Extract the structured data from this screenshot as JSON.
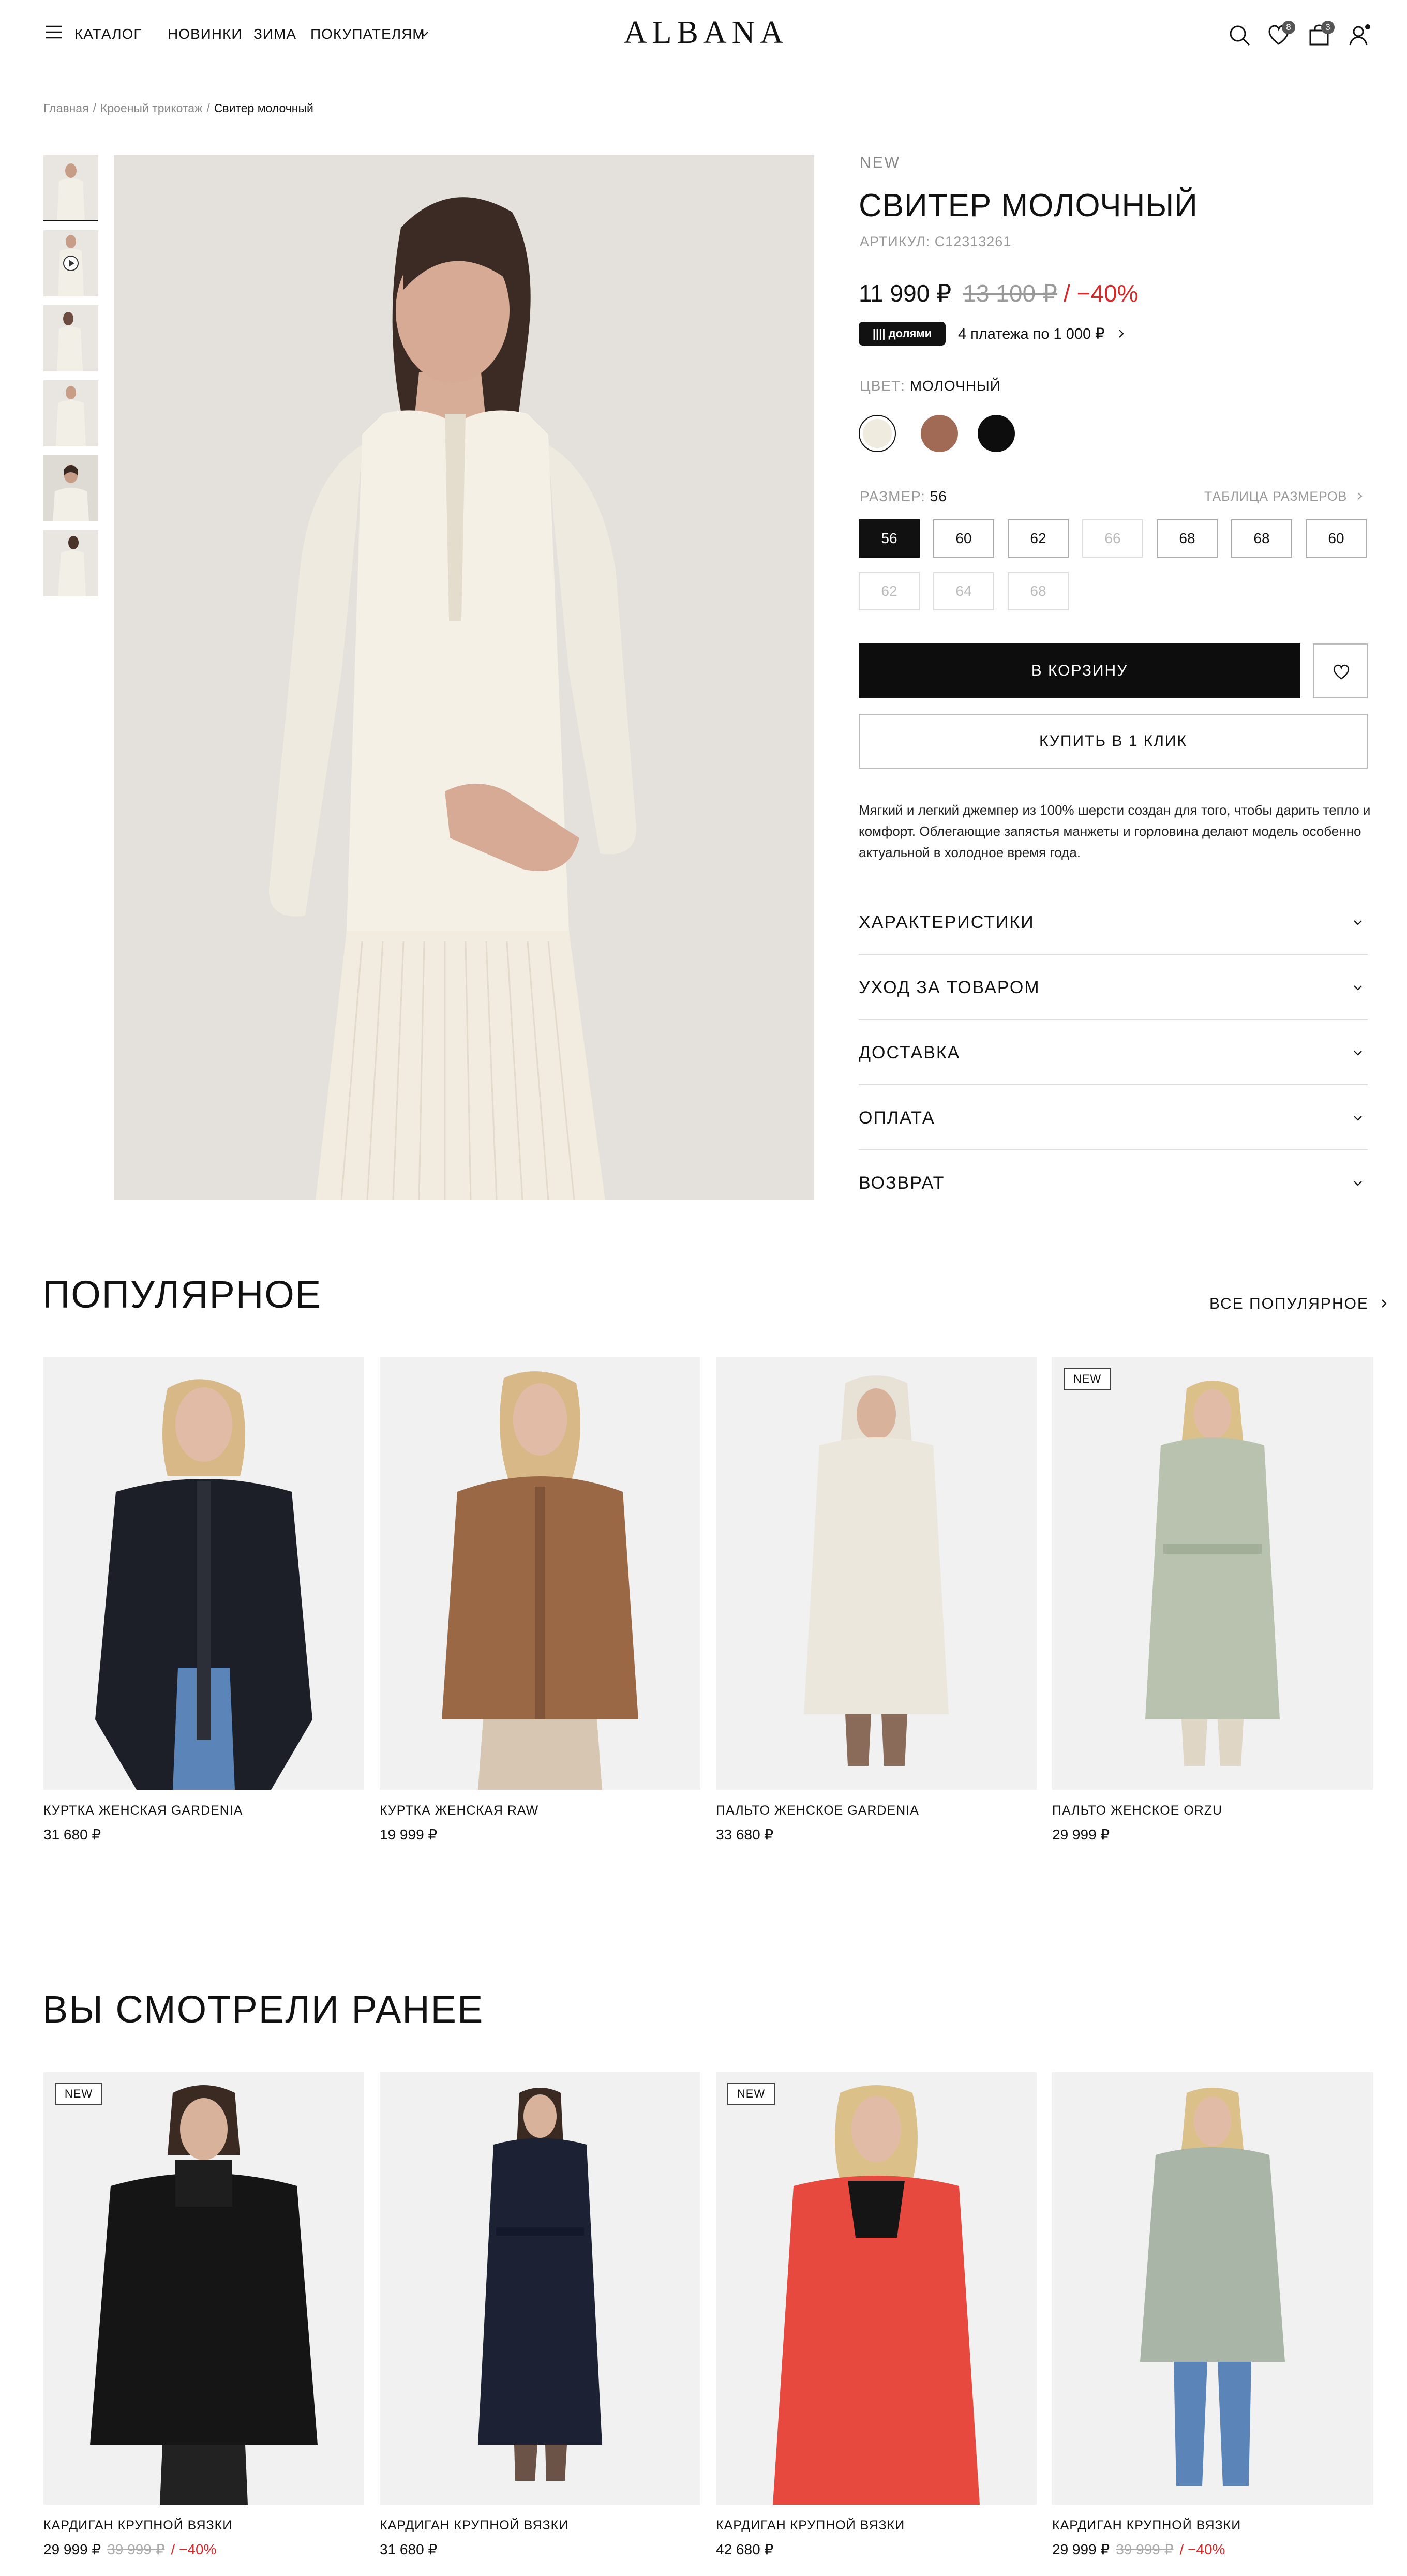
{
  "header": {
    "catalog": "КАТАЛОГ",
    "nav": [
      "НОВИНКИ",
      "ЗИМА",
      "ПОКУПАТЕЛЯМ"
    ],
    "logo": "ALBANA",
    "favorites_count": "8",
    "cart_count": "3"
  },
  "breadcrumbs": [
    "Главная",
    "Кроеный трикотаж",
    "Свитер молочный"
  ],
  "product": {
    "badge": "NEW",
    "title": "СВИТЕР МОЛОЧНЫЙ",
    "article": "АРТИКУЛ: С12313261",
    "price": "11 990 ₽",
    "old_price": "13 100 ₽",
    "discount": "/ −40%",
    "dolyami": "|||| долями",
    "installments": "4 платежа по 1 000 ₽",
    "color_label": "ЦВЕТ:",
    "color_value": "МОЛОЧНЫЙ",
    "colors": [
      "#efebdf",
      "#a06a55",
      "#0d0d0d"
    ],
    "size_label": "РАЗМЕР:",
    "size_value": "56",
    "size_table": "ТАБЛИЦА РАЗМЕРОВ",
    "sizes": [
      {
        "label": "56",
        "state": "selected"
      },
      {
        "label": "60",
        "state": "available"
      },
      {
        "label": "62",
        "state": "available"
      },
      {
        "label": "66",
        "state": "disabled"
      },
      {
        "label": "68",
        "state": "available"
      },
      {
        "label": "68",
        "state": "available"
      },
      {
        "label": "60",
        "state": "available"
      },
      {
        "label": "62",
        "state": "disabled"
      },
      {
        "label": "64",
        "state": "disabled"
      },
      {
        "label": "68",
        "state": "disabled"
      }
    ],
    "add_to_cart": "В КОРЗИНУ",
    "buy_one_click": "КУПИТЬ В 1 КЛИК",
    "description": "Мягкий и легкий джемпер из 100% шерсти создан для того, чтобы дарить тепло и комфорт. Облегающие запястья манжеты и горловина делают модель особенно актуальной в холодное время года.",
    "accordion": [
      "ХАРАКТЕРИСТИКИ",
      "УХОД ЗА ТОВАРОМ",
      "ДОСТАВКА",
      "ОПЛАТА",
      "ВОЗВРАТ"
    ]
  },
  "popular": {
    "title": "ПОПУЛЯРНОЕ",
    "all_link": "ВСЕ ПОПУЛЯРНОЕ",
    "items": [
      {
        "name": "КУРТКА ЖЕНСКАЯ GARDENIA",
        "price": "31 680 ₽",
        "new": false,
        "garment": "#1d1f28"
      },
      {
        "name": "КУРТКА ЖЕНСКАЯ RAW",
        "price": "19 999 ₽",
        "new": false,
        "garment": "#9a6845"
      },
      {
        "name": "ПАЛЬТО ЖЕНСКОЕ GARDENIA",
        "price": "33 680 ₽",
        "new": false,
        "garment": "#ece7dd"
      },
      {
        "name": "ПАЛЬТО ЖЕНСКОЕ ORZU",
        "price": "29 999 ₽",
        "new": true,
        "badge": "NEW",
        "garment": "#b8c2ae"
      }
    ]
  },
  "viewed": {
    "title": "ВЫ СМОТРЕЛИ РАНЕЕ",
    "items": [
      {
        "name": "КАРДИГАН КРУПНОЙ ВЯЗКИ",
        "price": "29 999 ₽",
        "old_price": "39 999 ₽",
        "discount": "/ −40%",
        "new": true,
        "badge": "NEW",
        "garment": "#151515"
      },
      {
        "name": "КАРДИГАН КРУПНОЙ ВЯЗКИ",
        "price": "31 680 ₽",
        "new": false,
        "garment": "#1c2233"
      },
      {
        "name": "КАРДИГАН КРУПНОЙ ВЯЗКИ",
        "price": "42 680 ₽",
        "new": true,
        "badge": "NEW",
        "garment": "#e8493e"
      },
      {
        "name": "КАРДИГАН КРУПНОЙ ВЯЗКИ",
        "price": "29 999 ₽",
        "old_price": "39 999 ₽",
        "discount": "/ −40%",
        "new": false,
        "garment": "#a9b5a6"
      }
    ]
  }
}
